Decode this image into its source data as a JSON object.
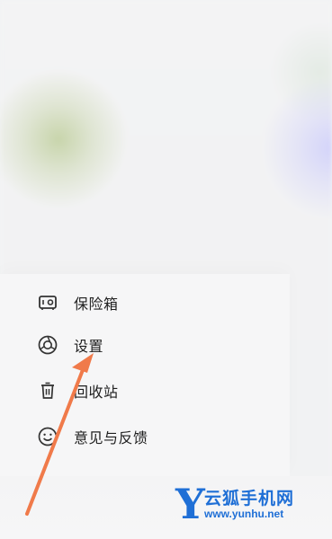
{
  "menu": {
    "items": [
      {
        "label": "保险箱",
        "icon": "safe-icon"
      },
      {
        "label": "设置",
        "icon": "settings-icon"
      },
      {
        "label": "回收站",
        "icon": "trash-icon"
      },
      {
        "label": "意见与反馈",
        "icon": "smile-icon"
      }
    ]
  },
  "watermark": {
    "letter": "Y",
    "brand": "云狐手机网",
    "url": "www.yunhu.net",
    "color": "#1f6fd6"
  },
  "annotation": {
    "arrow_color": "#f07a4a"
  }
}
